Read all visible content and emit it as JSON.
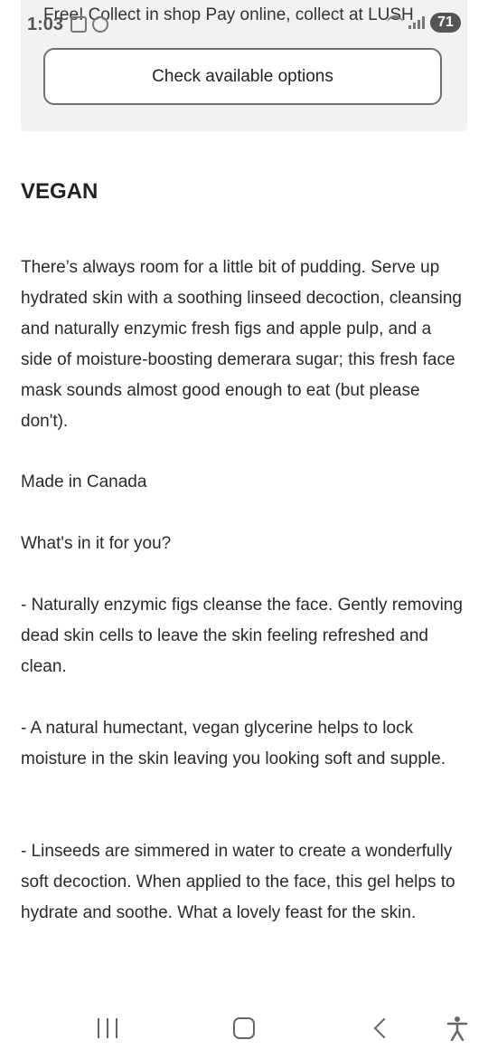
{
  "status_bar": {
    "time": "1:03",
    "battery": "71"
  },
  "options": {
    "shipping_text": "Free! Collect in shop Pay online, collect at LUSH",
    "check_button_label": "Check available options"
  },
  "product": {
    "heading": "VEGAN",
    "description": "There’s always room for a little bit of pudding. Serve up hydrated skin with a soothing linseed decoction, cleansing and naturally enzymic fresh figs and apple pulp, and a side of moisture-boosting demerara sugar; this fresh face mask sounds almost good enough to eat (but please don't).",
    "made_in": "Made in Canada",
    "benefits_heading": "What's in it for you?",
    "benefit_figs": "- Naturally enzymic figs cleanse the face. Gently removing dead skin cells to leave the skin feeling refreshed and clean.",
    "benefit_glycerine": "- A natural humectant, vegan glycerine helps to lock moisture in the skin leaving you looking soft and supple.",
    "benefit_linseeds": "- Linseeds are simmered in water to create a wonderfully soft decoction. When applied to the face, this gel helps to hydrate and soothe. What a lovely feast for the skin."
  },
  "nav_bar": {
    "recents_icon": "recents-icon",
    "home_icon": "home-icon",
    "back_icon": "back-icon",
    "accessibility_icon": "accessibility-icon"
  }
}
